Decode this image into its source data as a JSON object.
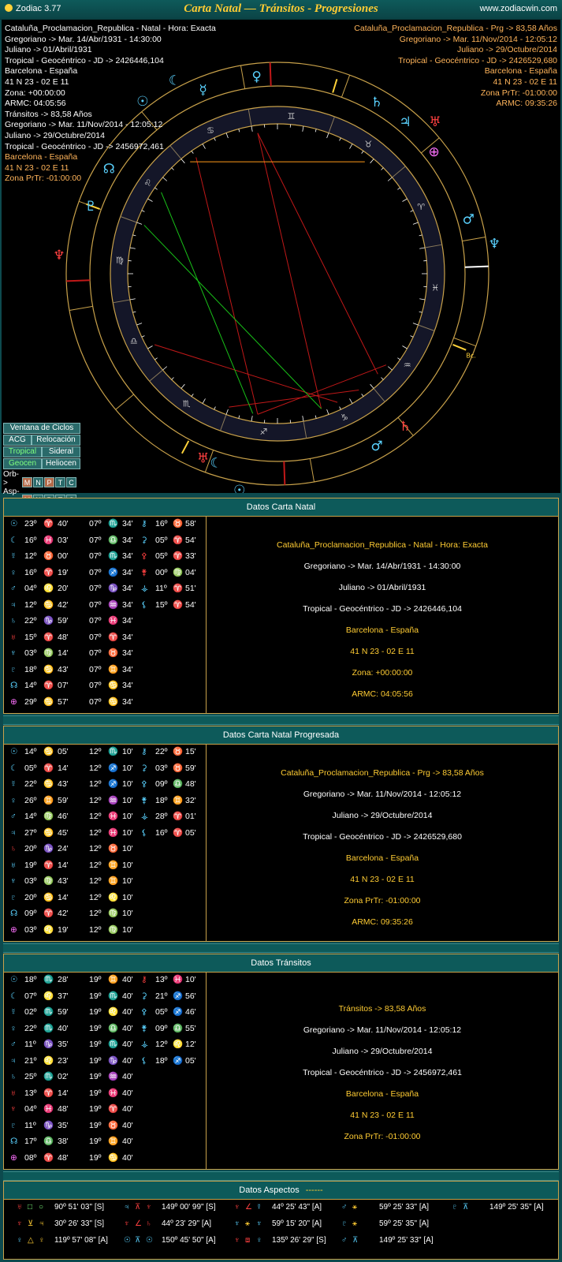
{
  "window": {
    "app_title": "Zodiac 3.77",
    "caption": "Carta Natal — Tránsitos - Progresiones",
    "url": "www.zodiacwin.com"
  },
  "info_left": [
    {
      "t": "Cataluña_Proclamacion_Republica - Natal - Hora: Exacta",
      "c": "w"
    },
    {
      "t": "Gregoriano -> Mar. 14/Abr/1931 - 14:30:00",
      "c": "w"
    },
    {
      "t": "Juliano -> 01/Abril/1931",
      "c": "w"
    },
    {
      "t": "Tropical - Geocéntrico - JD -> 2426446,104",
      "c": "w"
    },
    {
      "t": "Barcelona - España",
      "c": "w"
    },
    {
      "t": "41 N 23 - 02 E 11",
      "c": "w"
    },
    {
      "t": "Zona: +00:00:00",
      "c": "w"
    },
    {
      "t": "ARMC: 04:05:56",
      "c": "w"
    },
    {
      "t": "Tránsitos -> 83,58 Años",
      "c": "w"
    },
    {
      "t": "Gregoriano -> Mar. 11/Nov/2014 - 12:05:12",
      "c": "w"
    },
    {
      "t": "Juliano -> 29/Octubre/2014",
      "c": "w"
    },
    {
      "t": "Tropical - Geocéntrico - JD -> 2456972,461",
      "c": "w"
    },
    {
      "t": "Barcelona - España",
      "c": "o"
    },
    {
      "t": "41 N 23 - 02 E 11",
      "c": "o"
    },
    {
      "t": "Zona PrTr: -01:00:00",
      "c": "o"
    }
  ],
  "info_right": [
    "Cataluña_Proclamacion_Republica - Prg -> 83,58 Años",
    "Gregoriano -> Mar. 11/Nov/2014 - 12:05:12",
    "Juliano -> 29/Octubre/2014",
    "Tropical - Geocéntrico - JD -> 2426529,680",
    "Barcelona - España",
    "41 N 23 - 02 E 11",
    "Zona PrTr: -01:00:00",
    "ARMC: 09:35:26"
  ],
  "buttons": {
    "ventana": "Ventana de Ciclos",
    "acg": "ACG",
    "relocacion": "Relocación",
    "tropical": "Tropical",
    "sideral": "Sideral",
    "geocen": "Geocen",
    "heliocen": "Heliocen",
    "orb_label": "Orb->",
    "asp_label": "Asp->",
    "minis": [
      "M",
      "N",
      "P",
      "T",
      "C"
    ]
  },
  "natal": {
    "title": "Datos Carta Natal",
    "planets": [
      {
        "g": "☉",
        "c": "#5ad2ff",
        "d": "23º",
        "s": "♈",
        "m": "40'"
      },
      {
        "g": "☾",
        "c": "#5ad2ff",
        "d": "16º",
        "s": "♓",
        "m": "03'"
      },
      {
        "g": "☿",
        "c": "#5ad2ff",
        "d": "12º",
        "s": "♉",
        "m": "00'"
      },
      {
        "g": "♀",
        "c": "#5ad2ff",
        "d": "16º",
        "s": "♈",
        "m": "19'"
      },
      {
        "g": "♂",
        "c": "#5ad2ff",
        "d": "04º",
        "s": "♌",
        "m": "20'"
      },
      {
        "g": "♃",
        "c": "#5ad2ff",
        "d": "12º",
        "s": "♋",
        "m": "42'"
      },
      {
        "g": "♄",
        "c": "#5ad2ff",
        "d": "22º",
        "s": "♑",
        "m": "59'"
      },
      {
        "g": "♅",
        "c": "#ff4040",
        "d": "15º",
        "s": "♈",
        "m": "48'"
      },
      {
        "g": "♆",
        "c": "#5ad2ff",
        "d": "03º",
        "s": "♍",
        "m": "14'"
      },
      {
        "g": "♇",
        "c": "#5ad2ff",
        "d": "18º",
        "s": "♋",
        "m": "43'"
      },
      {
        "g": "☊",
        "c": "#5ad2ff",
        "d": "14º",
        "s": "♈",
        "m": "07'"
      },
      {
        "g": "⊕",
        "c": "#ff70ff",
        "d": "29º",
        "s": "♋",
        "m": "57'"
      }
    ],
    "houses": [
      {
        "d": "07º",
        "s": "♏",
        "m": "34'"
      },
      {
        "d": "07º",
        "s": "♎",
        "m": "34'"
      },
      {
        "d": "07º",
        "s": "♏",
        "m": "34'"
      },
      {
        "d": "07º",
        "s": "♐",
        "m": "34'"
      },
      {
        "d": "07º",
        "s": "♑",
        "m": "34'"
      },
      {
        "d": "07º",
        "s": "♒",
        "m": "34'"
      },
      {
        "d": "07º",
        "s": "♓",
        "m": "34'"
      },
      {
        "d": "07º",
        "s": "♈",
        "m": "34'"
      },
      {
        "d": "07º",
        "s": "♉",
        "m": "34'"
      },
      {
        "d": "07º",
        "s": "♊",
        "m": "34'"
      },
      {
        "d": "07º",
        "s": "♋",
        "m": "34'"
      },
      {
        "d": "07º",
        "s": "♋",
        "m": "34'"
      }
    ],
    "others": [
      {
        "g": "⚷",
        "c": "#5ad2ff",
        "d": "16º",
        "s": "♉",
        "m": "58'"
      },
      {
        "g": "⚳",
        "c": "#5ad2ff",
        "d": "05º",
        "s": "♈",
        "m": "54'"
      },
      {
        "g": "⚴",
        "c": "#ff4040",
        "d": "05º",
        "s": "♈",
        "m": "33'"
      },
      {
        "g": "⚵",
        "c": "#ff4040",
        "d": "00º",
        "s": "♍",
        "m": "04'"
      },
      {
        "g": "⚶",
        "c": "#5ad2ff",
        "d": "11º",
        "s": "♈",
        "m": "51'"
      },
      {
        "g": "⚸",
        "c": "#5ad2ff",
        "d": "15º",
        "s": "♈",
        "m": "54'"
      }
    ],
    "info": [
      {
        "t": "Cataluña_Proclamacion_Republica - Natal - Hora: Exacta",
        "c": "#ffcc33"
      },
      {
        "t": "Gregoriano -> Mar. 14/Abr/1931 - 14:30:00",
        "c": "#fff"
      },
      {
        "t": "Juliano -> 01/Abril/1931",
        "c": "#fff"
      },
      {
        "t": "Tropical - Geocéntrico - JD -> 2426446,104",
        "c": "#fff"
      },
      {
        "t": "Barcelona - España",
        "c": "#ffcc33"
      },
      {
        "t": "41 N 23 - 02 E 11",
        "c": "#ffcc33"
      },
      {
        "t": "Zona: +00:00:00",
        "c": "#ffcc33"
      },
      {
        "t": "ARMC: 04:05:56",
        "c": "#ffcc33"
      }
    ]
  },
  "progressed": {
    "title": "Datos Carta Natal Progresada",
    "planets": [
      {
        "g": "☉",
        "c": "#5ad2ff",
        "d": "14º",
        "s": "♋",
        "m": "05'"
      },
      {
        "g": "☾",
        "c": "#5ad2ff",
        "d": "05º",
        "s": "♈",
        "m": "14'"
      },
      {
        "g": "☿",
        "c": "#5ad2ff",
        "d": "22º",
        "s": "♋",
        "m": "43'"
      },
      {
        "g": "♀",
        "c": "#5ad2ff",
        "d": "26º",
        "s": "♊",
        "m": "59'"
      },
      {
        "g": "♂",
        "c": "#5ad2ff",
        "d": "14º",
        "s": "♍",
        "m": "46'"
      },
      {
        "g": "♃",
        "c": "#5ad2ff",
        "d": "27º",
        "s": "♋",
        "m": "45'"
      },
      {
        "g": "♄",
        "c": "#ff4040",
        "d": "20º",
        "s": "♑",
        "m": "24'"
      },
      {
        "g": "♅",
        "c": "#5ad2ff",
        "d": "19º",
        "s": "♈",
        "m": "14'"
      },
      {
        "g": "♆",
        "c": "#5ad2ff",
        "d": "03º",
        "s": "♍",
        "m": "43'"
      },
      {
        "g": "♇",
        "c": "#5ad2ff",
        "d": "20º",
        "s": "♋",
        "m": "14'"
      },
      {
        "g": "☊",
        "c": "#5ad2ff",
        "d": "09º",
        "s": "♈",
        "m": "42'"
      },
      {
        "g": "⊕",
        "c": "#ff70ff",
        "d": "03º",
        "s": "♌",
        "m": "19'"
      }
    ],
    "houses": [
      {
        "d": "12º",
        "s": "♏",
        "m": "10'"
      },
      {
        "d": "12º",
        "s": "♐",
        "m": "10'"
      },
      {
        "d": "12º",
        "s": "♐",
        "m": "10'"
      },
      {
        "d": "12º",
        "s": "♒",
        "m": "10'"
      },
      {
        "d": "12º",
        "s": "♓",
        "m": "10'"
      },
      {
        "d": "12º",
        "s": "♓",
        "m": "10'"
      },
      {
        "d": "12º",
        "s": "♉",
        "m": "10'"
      },
      {
        "d": "12º",
        "s": "♊",
        "m": "10'"
      },
      {
        "d": "12º",
        "s": "♊",
        "m": "10'"
      },
      {
        "d": "12º",
        "s": "♌",
        "m": "10'"
      },
      {
        "d": "12º",
        "s": "♍",
        "m": "10'"
      },
      {
        "d": "12º",
        "s": "♍",
        "m": "10'"
      }
    ],
    "others": [
      {
        "g": "⚷",
        "c": "#5ad2ff",
        "d": "22º",
        "s": "♉",
        "m": "15'"
      },
      {
        "g": "⚳",
        "c": "#5ad2ff",
        "d": "03º",
        "s": "♉",
        "m": "59'"
      },
      {
        "g": "⚴",
        "c": "#5ad2ff",
        "d": "09º",
        "s": "♎",
        "m": "48'"
      },
      {
        "g": "⚵",
        "c": "#5ad2ff",
        "d": "18º",
        "s": "♊",
        "m": "32'"
      },
      {
        "g": "⚶",
        "c": "#5ad2ff",
        "d": "28º",
        "s": "♈",
        "m": "01'"
      },
      {
        "g": "⚸",
        "c": "#5ad2ff",
        "d": "16º",
        "s": "♈",
        "m": "05'"
      }
    ],
    "info": [
      {
        "t": "Cataluña_Proclamacion_Republica - Prg -> 83,58 Años",
        "c": "#ffcc33"
      },
      {
        "t": "Gregoriano -> Mar. 11/Nov/2014 - 12:05:12",
        "c": "#fff"
      },
      {
        "t": "Juliano -> 29/Octubre/2014",
        "c": "#fff"
      },
      {
        "t": "Tropical - Geocéntrico - JD -> 2426529,680",
        "c": "#fff"
      },
      {
        "t": "Barcelona - España",
        "c": "#ffcc33"
      },
      {
        "t": "41 N 23 - 02 E 11",
        "c": "#ffcc33"
      },
      {
        "t": "Zona PrTr: -01:00:00",
        "c": "#ffcc33"
      },
      {
        "t": "ARMC: 09:35:26",
        "c": "#ffcc33"
      }
    ]
  },
  "transits": {
    "title": "Datos Tránsitos",
    "planets": [
      {
        "g": "☉",
        "c": "#5ad2ff",
        "d": "18º",
        "s": "♏",
        "m": "28'"
      },
      {
        "g": "☾",
        "c": "#5ad2ff",
        "d": "07º",
        "s": "♌",
        "m": "37'"
      },
      {
        "g": "☿",
        "c": "#5ad2ff",
        "d": "02º",
        "s": "♏",
        "m": "59'"
      },
      {
        "g": "♀",
        "c": "#5ad2ff",
        "d": "22º",
        "s": "♏",
        "m": "40'"
      },
      {
        "g": "♂",
        "c": "#5ad2ff",
        "d": "11º",
        "s": "♑",
        "m": "35'"
      },
      {
        "g": "♃",
        "c": "#5ad2ff",
        "d": "21º",
        "s": "♌",
        "m": "23'"
      },
      {
        "g": "♄",
        "c": "#5ad2ff",
        "d": "25º",
        "s": "♏",
        "m": "02'"
      },
      {
        "g": "♅",
        "c": "#ff4040",
        "d": "13º",
        "s": "♈",
        "m": "14'"
      },
      {
        "g": "♆",
        "c": "#ff4040",
        "d": "04º",
        "s": "♓",
        "m": "48'"
      },
      {
        "g": "♇",
        "c": "#5ad2ff",
        "d": "11º",
        "s": "♑",
        "m": "35'"
      },
      {
        "g": "☊",
        "c": "#5ad2ff",
        "d": "17º",
        "s": "♎",
        "m": "38'"
      },
      {
        "g": "⊕",
        "c": "#ff70ff",
        "d": "08º",
        "s": "♈",
        "m": "48'"
      }
    ],
    "houses": [
      {
        "d": "19º",
        "s": "♊",
        "m": "40'"
      },
      {
        "d": "19º",
        "s": "♏",
        "m": "40'"
      },
      {
        "d": "19º",
        "s": "♌",
        "m": "40'"
      },
      {
        "d": "19º",
        "s": "♎",
        "m": "40'"
      },
      {
        "d": "19º",
        "s": "♏",
        "m": "40'"
      },
      {
        "d": "19º",
        "s": "♑",
        "m": "40'"
      },
      {
        "d": "19º",
        "s": "♒",
        "m": "40'"
      },
      {
        "d": "19º",
        "s": "♓",
        "m": "40'"
      },
      {
        "d": "19º",
        "s": "♈",
        "m": "40'"
      },
      {
        "d": "19º",
        "s": "♉",
        "m": "40'"
      },
      {
        "d": "19º",
        "s": "♊",
        "m": "40'"
      },
      {
        "d": "19º",
        "s": "♋",
        "m": "40'"
      }
    ],
    "others": [
      {
        "g": "⚷",
        "c": "#ff4040",
        "d": "13º",
        "s": "♓",
        "m": "10'"
      },
      {
        "g": "⚳",
        "c": "#5ad2ff",
        "d": "21º",
        "s": "♐",
        "m": "56'"
      },
      {
        "g": "⚴",
        "c": "#5ad2ff",
        "d": "05º",
        "s": "♐",
        "m": "46'"
      },
      {
        "g": "⚵",
        "c": "#5ad2ff",
        "d": "09º",
        "s": "♎",
        "m": "55'"
      },
      {
        "g": "⚶",
        "c": "#5ad2ff",
        "d": "12º",
        "s": "♌",
        "m": "12'"
      },
      {
        "g": "⚸",
        "c": "#5ad2ff",
        "d": "18º",
        "s": "♐",
        "m": "05'"
      }
    ],
    "info": [
      {
        "t": "Tránsitos -> 83,58 Años",
        "c": "#ffcc33"
      },
      {
        "t": "Gregoriano -> Mar. 11/Nov/2014 - 12:05:12",
        "c": "#fff"
      },
      {
        "t": "Juliano -> 29/Octubre/2014",
        "c": "#fff"
      },
      {
        "t": "Tropical - Geocéntrico - JD -> 2456972,461",
        "c": "#fff"
      },
      {
        "t": "Barcelona - España",
        "c": "#ffcc33"
      },
      {
        "t": "41 N 23 - 02 E 11",
        "c": "#ffcc33"
      },
      {
        "t": "Zona PrTr: -01:00:00",
        "c": "#ffcc33"
      }
    ]
  },
  "aspects": {
    "title": "Datos Aspectos",
    "dash": "------",
    "rows": [
      [
        {
          "a": "♅",
          "b": "□",
          "c2": "○",
          "v": "90º 51' 03\" [S]",
          "ca": "#ff4040",
          "cb": "#7fff7f",
          "cc": "#7fff7f"
        },
        {
          "a": "♃",
          "b": "⊼",
          "c2": "♆",
          "v": "149º 00' 99\" [S]",
          "ca": "#5ad2ff",
          "cb": "#ff4040",
          "cc": "#ff4040"
        },
        {
          "a": "♆",
          "b": "∠",
          "c2": "☿",
          "v": "44º 25' 43\" [A]",
          "ca": "#ff4040",
          "cb": "#ff4040",
          "cc": "#5ad2ff"
        },
        {
          "a": "♂",
          "b": "⚹",
          "c2": "",
          "v": "59º 25' 33\" [A]",
          "ca": "#5ad2ff",
          "cb": "#ffcc33",
          "cc": "#fff"
        },
        {
          "a": "♇",
          "b": "⊼",
          "c2": "",
          "v": "149º 25' 35\" [A]",
          "ca": "#5ad2ff",
          "cb": "#5ad2ff",
          "cc": "#fff"
        }
      ],
      [
        {
          "a": "♆",
          "b": "⊻",
          "c2": "♃",
          "v": "30º 26' 33\" [S]",
          "ca": "#ff4040",
          "cb": "#ffcc33",
          "cc": "#ffcc33"
        },
        {
          "a": "♆",
          "b": "∠",
          "c2": "♄",
          "v": "44º 23' 29\" [A]",
          "ca": "#ff4040",
          "cb": "#ff4040",
          "cc": "#ff4040"
        },
        {
          "a": "♆",
          "b": "⚹",
          "c2": "♆",
          "v": "59º 15' 20\" [A]",
          "ca": "#5ad2ff",
          "cb": "#ffcc33",
          "cc": "#5ad2ff"
        },
        {
          "a": "♇",
          "b": "⚹",
          "c2": "",
          "v": "59º 25' 35\" [A]",
          "ca": "#5ad2ff",
          "cb": "#ffcc33",
          "cc": "#fff"
        },
        {
          "a": "",
          "b": "",
          "c2": "",
          "v": "",
          "ca": "#fff",
          "cb": "#fff",
          "cc": "#fff"
        }
      ],
      [
        {
          "a": "♀",
          "b": "△",
          "c2": "♀",
          "v": "119º 57' 08\" [A]",
          "ca": "#5ad2ff",
          "cb": "#ffcc33",
          "cc": "#ffcc33"
        },
        {
          "a": "☉",
          "b": "⊼",
          "c2": "☉",
          "v": "150º 45' 50\" [A]",
          "ca": "#5ad2ff",
          "cb": "#5ad2ff",
          "cc": "#5ad2ff"
        },
        {
          "a": "♆",
          "b": "⧈",
          "c2": "♀",
          "v": "135º 26' 29\" [S]",
          "ca": "#ff4040",
          "cb": "#ff4040",
          "cc": "#5ad2ff"
        },
        {
          "a": "♂",
          "b": "⊼",
          "c2": "",
          "v": "149º 25' 33\" [A]",
          "ca": "#5ad2ff",
          "cb": "#5ad2ff",
          "cc": "#fff"
        },
        {
          "a": "",
          "b": "",
          "c2": "",
          "v": "",
          "ca": "#fff",
          "cb": "#fff",
          "cc": "#fff"
        }
      ]
    ]
  },
  "wheel": {
    "zodiac_glyphs": [
      "♈",
      "♉",
      "♊",
      "♋",
      "♌",
      "♍",
      "♎",
      "♏",
      "♐",
      "♑",
      "♒",
      "♓"
    ],
    "outer_planets": [
      {
        "g": "☾",
        "c": "#5ad2ff"
      },
      {
        "g": "♀",
        "c": "#5ad2ff"
      },
      {
        "g": "☿",
        "c": "#5ad2ff"
      },
      {
        "g": "☉",
        "c": "#5ad2ff"
      },
      {
        "g": "♄",
        "c": "#5ad2ff"
      },
      {
        "g": "♃",
        "c": "#5ad2ff"
      },
      {
        "g": "♅",
        "c": "#ff4040"
      },
      {
        "g": "⊕",
        "c": "#ff70ff"
      },
      {
        "g": "♂",
        "c": "#5ad2ff"
      },
      {
        "g": "♆",
        "c": "#5ad2ff"
      },
      {
        "g": "♇",
        "c": "#5ad2ff"
      },
      {
        "g": "☊",
        "c": "#5ad2ff"
      },
      {
        "g": "♆",
        "c": "#ff4040"
      },
      {
        "g": "♄",
        "c": "#ff4040"
      },
      {
        "g": "♂",
        "c": "#5ad2ff"
      },
      {
        "g": "☉",
        "c": "#5ad2ff"
      },
      {
        "g": "☾",
        "c": "#5ad2ff"
      },
      {
        "g": "♅",
        "c": "#ff4040"
      }
    ],
    "marker_label": "Bc."
  }
}
